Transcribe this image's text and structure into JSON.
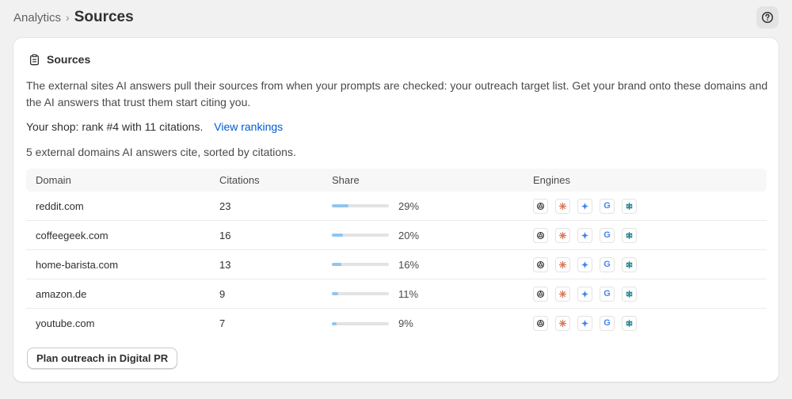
{
  "breadcrumb": {
    "parent": "Analytics",
    "separator": "›",
    "current": "Sources"
  },
  "header": {
    "help_icon": "question-circle-icon"
  },
  "card": {
    "icon": "clipboard-icon",
    "title": "Sources",
    "description": "The external sites AI answers pull their sources from when your prompts are checked: your outreach target list. Get your brand onto these domains and the AI answers that trust them start citing you.",
    "rank_text": "Your shop: rank #4 with 11 citations.",
    "rank_link": "View rankings",
    "count_text": "5 external domains AI answers cite, sorted by citations.",
    "cta_label": "Plan outreach in Digital PR"
  },
  "table": {
    "headers": {
      "domain": "Domain",
      "citations": "Citations",
      "share": "Share",
      "engines": "Engines"
    },
    "rows": [
      {
        "domain": "reddit.com",
        "citations": "23",
        "share": "29%",
        "share_fraction": 0.29
      },
      {
        "domain": "coffeegeek.com",
        "citations": "16",
        "share": "20%",
        "share_fraction": 0.2
      },
      {
        "domain": "home-barista.com",
        "citations": "13",
        "share": "16%",
        "share_fraction": 0.16
      },
      {
        "domain": "amazon.de",
        "citations": "9",
        "share": "11%",
        "share_fraction": 0.11
      },
      {
        "domain": "youtube.com",
        "citations": "7",
        "share": "9%",
        "share_fraction": 0.09
      }
    ],
    "engines": [
      "chatgpt-icon",
      "claude-icon",
      "gemini-icon",
      "google-icon",
      "perplexity-icon"
    ]
  },
  "colors": {
    "link": "#005bd3",
    "bar_fill": "#8ec5f2",
    "claude": "#d97757",
    "gemini": "#4285f4",
    "perplexity": "#20808d"
  }
}
